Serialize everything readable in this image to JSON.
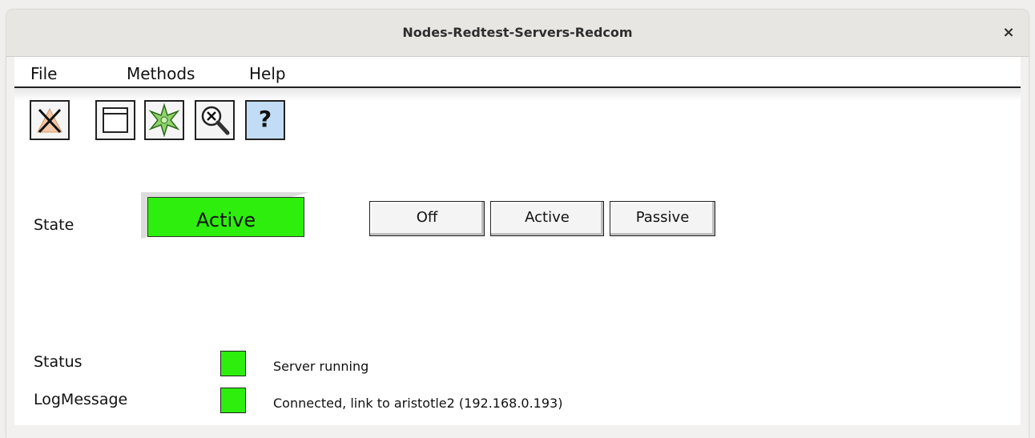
{
  "window": {
    "title": "Nodes-Redtest-Servers-Redcom",
    "close_glyph": "×"
  },
  "menu": [
    {
      "label": "File"
    },
    {
      "label": "Methods"
    },
    {
      "label": "Help"
    }
  ],
  "toolbar": [
    {
      "icon": "close-graph-icon"
    },
    {
      "icon": "open-window-icon"
    },
    {
      "icon": "navigator-icon"
    },
    {
      "icon": "object-inspector-icon"
    },
    {
      "icon": "help-icon",
      "glyph": "?"
    }
  ],
  "state": {
    "label": "State",
    "value": "Active",
    "color": "#2dee0c",
    "buttons": [
      {
        "label": "Off"
      },
      {
        "label": "Active"
      },
      {
        "label": "Passive"
      }
    ]
  },
  "status": {
    "label": "Status",
    "text": "Server running",
    "color": "#2dee0c"
  },
  "log": {
    "label": "LogMessage",
    "text": "Connected, link to aristotle2 (192.168.0.193)",
    "color": "#2dee0c"
  }
}
